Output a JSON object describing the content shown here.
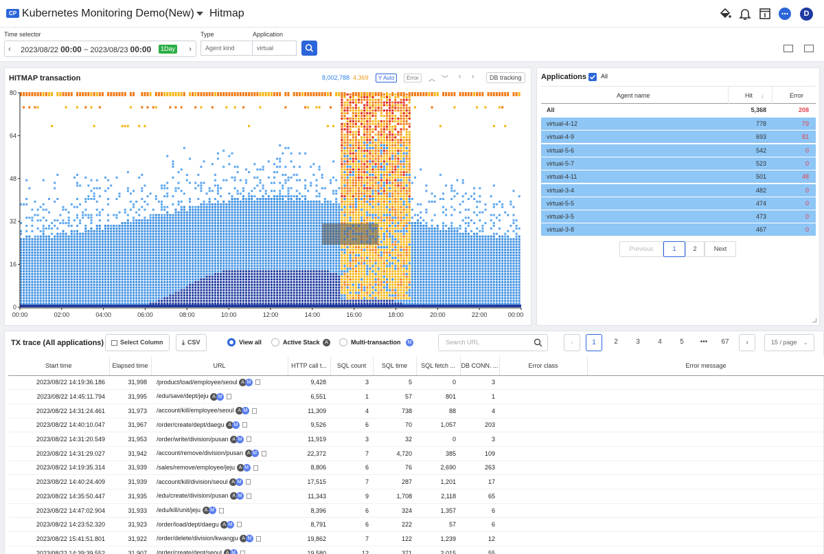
{
  "header": {
    "project_badge": "CP",
    "project_name": "Kubernetes Monitoring Demo(New)",
    "page_title": "Hitmap",
    "user_initial": "D"
  },
  "filters": {
    "time_label": "Time selector",
    "time_start_date": "2023/08/22",
    "time_start_time": "00:00",
    "time_sep": "~",
    "time_end_date": "2023/08/23",
    "time_end_time": "00:00",
    "time_badge": "1Day",
    "type_label": "Type",
    "type_value": "Agent kind",
    "app_label": "Application",
    "app_value": "virtual"
  },
  "hitmap": {
    "title": "HITMAP transaction",
    "hit_count": "8,002,788",
    "error_count": "4,369",
    "y_auto": "Y Auto",
    "error_chip": "Error",
    "db_tracking": "DB tracking"
  },
  "chart_data": {
    "type": "heatmap",
    "title": "HITMAP transaction",
    "x_ticks": [
      "00:00",
      "02:00",
      "04:00",
      "06:00",
      "08:00",
      "10:00",
      "12:00",
      "14:00",
      "16:00",
      "18:00",
      "20:00",
      "22:00",
      "00:00"
    ],
    "y_ticks": [
      0,
      16,
      32,
      48,
      64,
      80
    ],
    "ylim": [
      0,
      80
    ],
    "xlim": [
      "00:00",
      "24:00"
    ],
    "colors": {
      "low": "#1e3a9e",
      "mid": "#3d8fe0",
      "high": "#5ba6f0",
      "error_low": "#f5b719",
      "error_mid": "#f07c1a",
      "error_high": "#e0261d"
    },
    "error_burst_window": [
      "15:20",
      "18:40"
    ]
  },
  "applications": {
    "title": "Applications",
    "all_label": "All",
    "columns": [
      "Agent name",
      "Hit",
      "Error"
    ],
    "total": {
      "name": "All",
      "hit": "5,368",
      "error": "208"
    },
    "rows": [
      {
        "name": "virtual-4-12",
        "hit": "778",
        "error": "79"
      },
      {
        "name": "virtual-4-9",
        "hit": "693",
        "error": "81"
      },
      {
        "name": "virtual-5-6",
        "hit": "542",
        "error": "0"
      },
      {
        "name": "virtual-5-7",
        "hit": "523",
        "error": "0"
      },
      {
        "name": "virtual-4-11",
        "hit": "501",
        "error": "48"
      },
      {
        "name": "virtual-3-4",
        "hit": "482",
        "error": "0"
      },
      {
        "name": "virtual-5-5",
        "hit": "474",
        "error": "0"
      },
      {
        "name": "virtual-3-5",
        "hit": "473",
        "error": "0"
      },
      {
        "name": "virtual-3-8",
        "hit": "467",
        "error": "0"
      }
    ],
    "pager": {
      "prev": "Previous",
      "p1": "1",
      "p2": "2",
      "next": "Next"
    }
  },
  "tx": {
    "title": "TX trace (All applications)",
    "select_column": "Select Column",
    "csv": "CSV",
    "view_all": "View all",
    "active_stack": "Active Stack",
    "multi_tx": "Multi-transaction",
    "badge_a": "A",
    "badge_m": "M",
    "search_placeholder": "Search URL",
    "pages": [
      "1",
      "2",
      "3",
      "4",
      "5",
      "•••",
      "67"
    ],
    "page_size": "15 / page",
    "columns": [
      "Start time",
      "Elapsed time",
      "URL",
      "HTTP call t...",
      "SQL count",
      "SQL time",
      "SQL fetch ...",
      "DB CONN. ...",
      "Error class",
      "Error message"
    ],
    "rows": [
      [
        "2023/08/22 14:19:36.186",
        "31,998",
        "/product/load/employee/seoul",
        "9,428",
        "3",
        "5",
        "0",
        "3"
      ],
      [
        "2023/08/22 14:45:11.794",
        "31,995",
        "/edu/save/dept/jeju",
        "6,551",
        "1",
        "57",
        "801",
        "1"
      ],
      [
        "2023/08/22 14:31:24.461",
        "31,973",
        "/account/kill/employee/seoul",
        "11,309",
        "4",
        "738",
        "88",
        "4"
      ],
      [
        "2023/08/22 14:40:10.047",
        "31,967",
        "/order/create/dept/daegu",
        "9,526",
        "6",
        "70",
        "1,057",
        "203"
      ],
      [
        "2023/08/22 14:31:20.549",
        "31,953",
        "/order/write/division/pusan",
        "11,919",
        "3",
        "32",
        "0",
        "3"
      ],
      [
        "2023/08/22 14:31:29.027",
        "31,942",
        "/account/remove/division/pusan",
        "22,372",
        "7",
        "4,720",
        "385",
        "109"
      ],
      [
        "2023/08/22 14:19:35.314",
        "31,939",
        "/sales/remove/employee/jeju",
        "8,806",
        "6",
        "76",
        "2,690",
        "263"
      ],
      [
        "2023/08/22 14:40:24.409",
        "31,939",
        "/account/kill/division/seoul",
        "17,515",
        "7",
        "287",
        "1,201",
        "17"
      ],
      [
        "2023/08/22 14:35:50.447",
        "31,935",
        "/edu/create/division/pusan",
        "11,343",
        "9",
        "1,708",
        "2,118",
        "65"
      ],
      [
        "2023/08/22 14:47:02.904",
        "31,933",
        "/edu/kill/unit/jeju",
        "8,396",
        "6",
        "324",
        "1,357",
        "6"
      ],
      [
        "2023/08/22 14:23:52.320",
        "31,923",
        "/order/load/dept/daegu",
        "8,791",
        "6",
        "222",
        "57",
        "6"
      ],
      [
        "2023/08/22 15:41:51.801",
        "31,922",
        "/order/delete/division/kwangju",
        "19,862",
        "7",
        "122",
        "1,239",
        "12"
      ],
      [
        "2023/08/22 14:39:39.552",
        "31,907",
        "/order/create/dept/seoul",
        "19,580",
        "12",
        "371",
        "2,015",
        "55"
      ]
    ]
  }
}
